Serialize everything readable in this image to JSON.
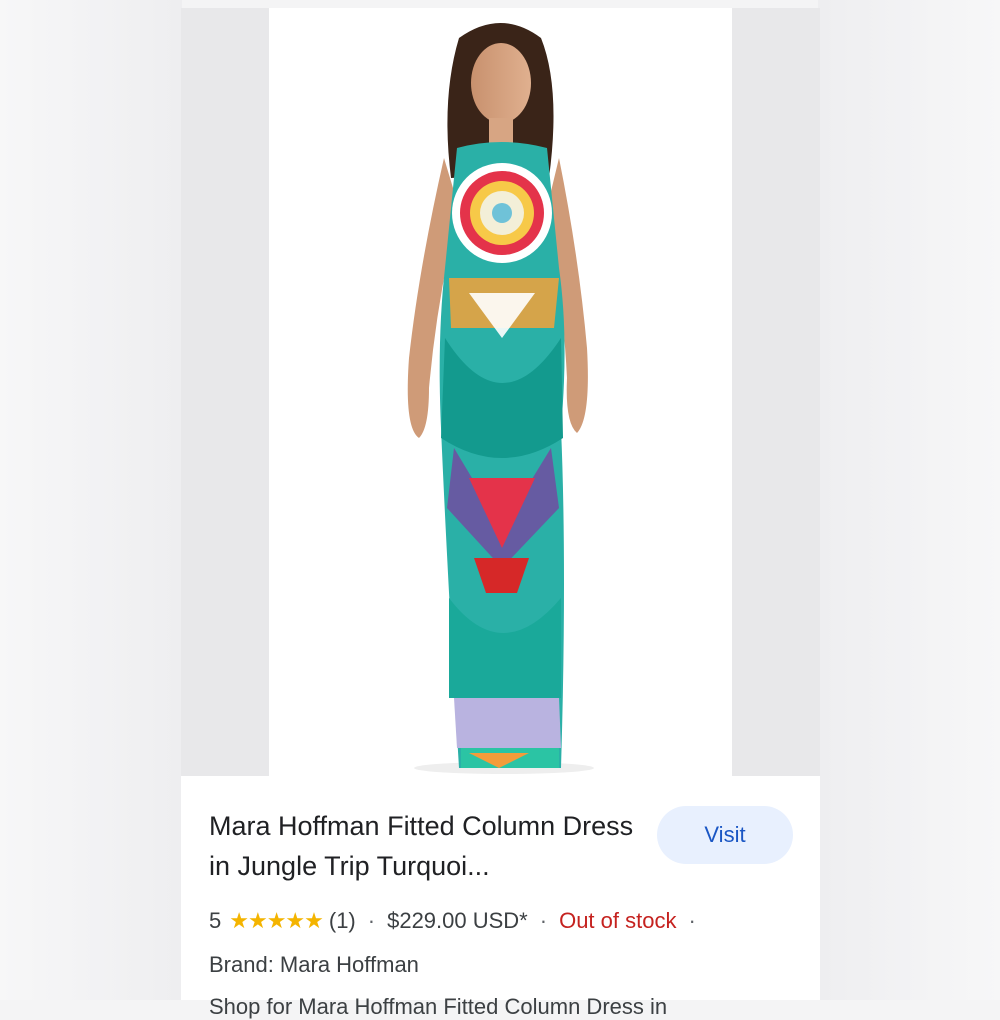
{
  "product": {
    "title": "Mara Hoffman Fitted Column Dress in Jungle Trip Turquoi...",
    "visit_label": "Visit",
    "rating": "5",
    "stars": "★★★★★",
    "review_count": "(1)",
    "price": "$229.00 USD*",
    "stock_status": "Out of stock",
    "brand": "Brand: Mara Hoffman",
    "snippet": "Shop for Mara Hoffman Fitted Column Dress in"
  },
  "colors": {
    "star": "#f4b400",
    "out_of_stock": "#c5221f",
    "visit_bg": "#e8f0fe",
    "visit_text": "#1a56c4"
  }
}
